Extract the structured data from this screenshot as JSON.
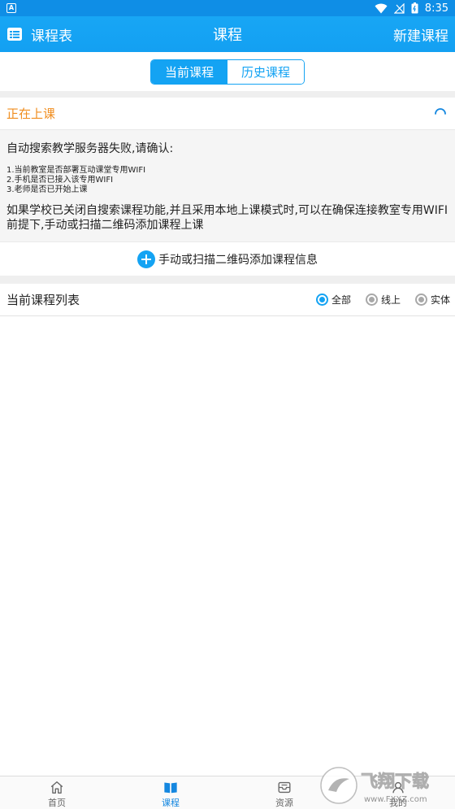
{
  "status_bar": {
    "time": "8:35",
    "left_badge": "A"
  },
  "header": {
    "left_label": "课程表",
    "title": "课程",
    "right_label": "新建课程"
  },
  "segments": [
    {
      "label": "当前课程",
      "active": true
    },
    {
      "label": "历史课程",
      "active": false
    }
  ],
  "inclass": {
    "label": "正在上课"
  },
  "info": {
    "headline": "自动搜索教学服务器失败,请确认:",
    "items": [
      "1.当前教室是否部署互动课堂专用WIFI",
      "2.手机是否已接入该专用WIFI",
      "3.老师是否已开始上课"
    ],
    "paragraph": "如果学校已关闭自搜索课程功能,并且采用本地上课模式时,可以在确保连接教室专用WIFI前提下,手动或扫描二维码添加课程上课"
  },
  "add_course": {
    "label": "手动或扫描二维码添加课程信息"
  },
  "course_list": {
    "title": "当前课程列表",
    "filters": [
      {
        "label": "全部",
        "checked": true
      },
      {
        "label": "线上",
        "checked": false
      },
      {
        "label": "实体",
        "checked": false
      }
    ]
  },
  "bottom_nav": [
    {
      "label": "首页",
      "icon": "home-icon",
      "active": false
    },
    {
      "label": "课程",
      "icon": "book-icon",
      "active": true
    },
    {
      "label": "资源",
      "icon": "inbox-icon",
      "active": false
    },
    {
      "label": "我的",
      "icon": "user-icon",
      "active": false
    }
  ],
  "watermark": {
    "title": "飞翔下载",
    "url": "www.FXXZ.com"
  },
  "colors": {
    "accent": "#14a3f3",
    "orange": "#f08d1e",
    "nav_active": "#1487e0"
  }
}
